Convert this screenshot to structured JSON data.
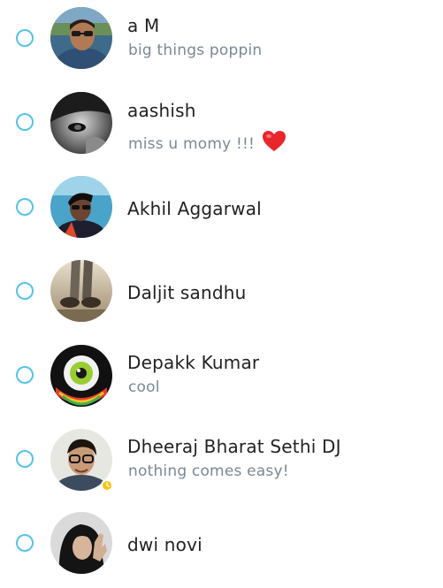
{
  "contacts": [
    {
      "name": "a M",
      "status": "big things poppin"
    },
    {
      "name": "aashish",
      "status": "miss u momy !!!",
      "status_emoji": "heart"
    },
    {
      "name": "Akhil Aggarwal",
      "status": ""
    },
    {
      "name": "Daljit sandhu",
      "status": ""
    },
    {
      "name": "Depakk Kumar",
      "status": "cool"
    },
    {
      "name": "Dheeraj Bharat Sethi DJ",
      "status": "nothing comes easy!",
      "presence": "away"
    },
    {
      "name": "dwi novi",
      "status": ""
    }
  ],
  "colors": {
    "radio_border": "#55c3e6",
    "name_text": "#222222",
    "status_text": "#7a8894",
    "away_badge": "#f5c518",
    "heart": "#e8262c"
  }
}
